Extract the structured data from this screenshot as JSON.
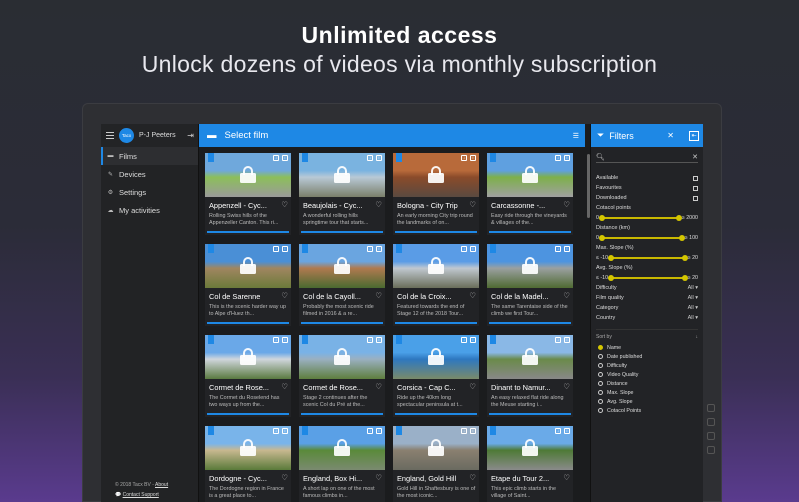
{
  "hero": {
    "title": "Unlimited access",
    "subtitle": "Unlock dozens of videos via monthly subscription"
  },
  "nav": {
    "user": "P-J Peeters",
    "logo": "Tacx",
    "items": [
      {
        "label": "Films",
        "icon": "film-icon",
        "active": true
      },
      {
        "label": "Devices",
        "icon": "wrench-icon",
        "active": false
      },
      {
        "label": "Settings",
        "icon": "gear-icon",
        "active": false
      },
      {
        "label": "My activities",
        "icon": "cloud-icon",
        "active": false
      }
    ],
    "footer": {
      "copyright": "© 2018 Tacx BV -",
      "about": "About",
      "support": "Contact Support"
    }
  },
  "topbar": {
    "title": "Select film"
  },
  "films": [
    {
      "title": "Appenzell - Cyc...",
      "desc": "Rolling Swiss hills of the Appenzeller Canton. This ri...",
      "colors": [
        "#6fa8dc",
        "#8cbf5a",
        "#9a9a9a"
      ]
    },
    {
      "title": "Beaujolais - Cyc...",
      "desc": "A wonderful rolling hills springtime tour that starts...",
      "colors": [
        "#7ab3e0",
        "#b8c9d6",
        "#7a7f6a"
      ]
    },
    {
      "title": "Bologna - City Trip",
      "desc": "An early morning City trip round the landmarks of on...",
      "colors": [
        "#b86a3a",
        "#8a4b2a",
        "#5a4a40"
      ]
    },
    {
      "title": "Carcassonne -...",
      "desc": "Easy ride through the vineyards & villages of the...",
      "colors": [
        "#5fa0e0",
        "#7db04a",
        "#a0a0a0"
      ]
    },
    {
      "title": "Col de Sarenne",
      "desc": "This is the scenic harder way up to Alpe d'Huez th...",
      "colors": [
        "#4a8fd6",
        "#a08660",
        "#6b7a3a"
      ]
    },
    {
      "title": "Col de la Cayoll...",
      "desc": "Probably the most scenic ride filmed in 2016 & a re...",
      "colors": [
        "#6aa5e0",
        "#b07a50",
        "#4a6a30"
      ]
    },
    {
      "title": "Col de la Croix...",
      "desc": "Featured towards the end of Stage 12 of the 2018 Tour...",
      "colors": [
        "#5a9ce6",
        "#c0c8d0",
        "#6a6e5a"
      ]
    },
    {
      "title": "Col de la Madel...",
      "desc": "The same Tarentaise side of the climb we first Tour...",
      "colors": [
        "#4d94e0",
        "#9aa0a0",
        "#4f6a32"
      ]
    },
    {
      "title": "Cormet de Rose...",
      "desc": "The Cormet du Roselend has two ways up from the...",
      "colors": [
        "#6aa8e8",
        "#d0d6dc",
        "#5a7a40"
      ]
    },
    {
      "title": "Cormet de Rose...",
      "desc": "Stage 2 continues after the scenic Col du Pré at the...",
      "colors": [
        "#79b2e6",
        "#9ab0c0",
        "#5e7e3e"
      ]
    },
    {
      "title": "Corsica - Cap C...",
      "desc": "Ride up the 40km long spectacular peninsula at t...",
      "colors": [
        "#4aa0e8",
        "#2e78c0",
        "#7a8a6a"
      ]
    },
    {
      "title": "Dinant to Namur...",
      "desc": "An easy relaxed flat ride along the Meuse starting i...",
      "colors": [
        "#8ab8e6",
        "#6a8a4a",
        "#888888"
      ]
    },
    {
      "title": "Dordogne - Cyc...",
      "desc": "The Dordogne region in France is a great place to...",
      "colors": [
        "#79b4ea",
        "#c8b890",
        "#5a7a3a"
      ]
    },
    {
      "title": "England, Box Hi...",
      "desc": "A short lap on one of the most famous climbs in...",
      "colors": [
        "#5aa0e6",
        "#5a8a3a",
        "#7a8a70"
      ]
    },
    {
      "title": "England, Gold Hill",
      "desc": "Gold Hill in Shaftesbury is one of the most iconic...",
      "colors": [
        "#9ab0c8",
        "#8a8070",
        "#6a6a60"
      ]
    },
    {
      "title": "Etape du Tour 2...",
      "desc": "This epic climb starts in the village of Saint...",
      "colors": [
        "#6aaae8",
        "#4e7a36",
        "#8a8a8a"
      ]
    }
  ],
  "filters": {
    "title": "Filters",
    "toggles": [
      {
        "label": "Available"
      },
      {
        "label": "Favourites"
      },
      {
        "label": "Downloaded"
      }
    ],
    "cotacol": {
      "label": "Cotacol points",
      "min": "0",
      "max": "≥ 2000"
    },
    "distance": {
      "label": "Distance  (km)",
      "min": "0",
      "max": "≥ 100"
    },
    "max_slope": {
      "label": "Max. Slope  (%)",
      "min": "≤ -10",
      "max": "≥ 20"
    },
    "avg_slope": {
      "label": "Avg. Slope  (%)",
      "min": "≤ -10",
      "max": "≥ 20"
    },
    "selects": [
      {
        "label": "Difficulty",
        "value": "All ▾"
      },
      {
        "label": "Film quality",
        "value": "All ▾"
      },
      {
        "label": "Category",
        "value": "All ▾"
      },
      {
        "label": "Country",
        "value": "All ▾"
      }
    ],
    "sort_by": "Sort by",
    "sort_options": [
      "Name",
      "Date published",
      "Difficulty",
      "Video Quality",
      "Distance",
      "Max. Slope",
      "Avg. Slope",
      "Cotacol Points"
    ],
    "sort_selected": 0
  }
}
